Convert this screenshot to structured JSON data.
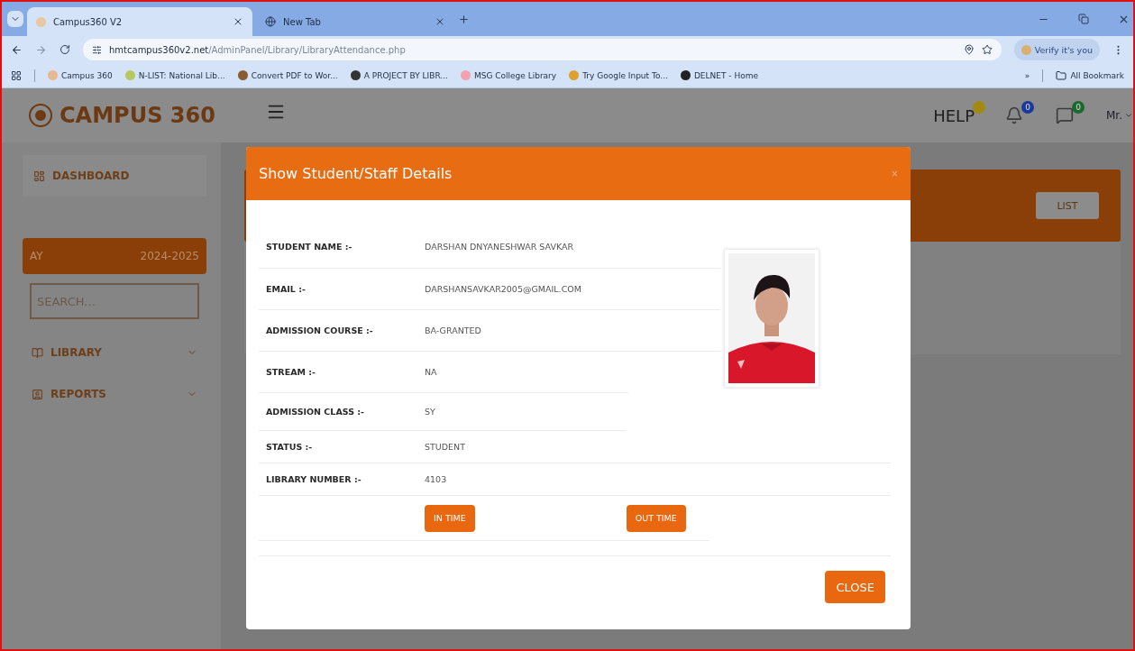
{
  "browser": {
    "tabs": [
      {
        "title": "Campus360 V2",
        "selected": true
      },
      {
        "title": "New Tab",
        "selected": false
      }
    ],
    "url": {
      "host": "hmtcampus360v2.net",
      "path": "/AdminPanel/Library/LibraryAttendance.php"
    },
    "profile_button": "Verify it's you",
    "bookmarks": [
      "Campus 360",
      "N-LIST: National Lib...",
      "Convert PDF to Wor...",
      "A PROJECT BY LIBR...",
      "MSG College Library",
      "Try Google Input To...",
      "DELNET - Home"
    ],
    "overflow": "»",
    "all_bookmarks": "All Bookmark"
  },
  "app": {
    "logo": "CAMPUS 360",
    "header": {
      "help": "HELP",
      "notifications": "0",
      "messages": "0",
      "user": "Mr."
    },
    "sidebar": {
      "dashboard": "DASHBOARD",
      "year": {
        "label": "AY",
        "value": "2024-2025"
      },
      "search": {
        "placeholder": "SEARCH..."
      },
      "menu": [
        {
          "label": "LIBRARY",
          "kind": "library"
        },
        {
          "label": "REPORTS",
          "kind": "reports"
        }
      ]
    },
    "list_button": "LIST"
  },
  "modal": {
    "title": "Show Student/Staff Details",
    "close_symbol": "×",
    "fields": [
      {
        "label": "STUDENT NAME :-",
        "value": "DARSHAN DNYANESHWAR SAVKAR"
      },
      {
        "label": "EMAIL :-",
        "value": "DARSHANSAVKAR2005@GMAIL.COM"
      },
      {
        "label": "ADMISSION COURSE :-",
        "value": "BA-GRANTED"
      },
      {
        "label": "STREAM :-",
        "value": "NA"
      },
      {
        "label": "ADMISSION CLASS :-",
        "value": "SY"
      },
      {
        "label": "STATUS :-",
        "value": "STUDENT"
      },
      {
        "label": "LIBRARY NUMBER :-",
        "value": "4103"
      }
    ],
    "in_button": "IN TIME",
    "out_button": "OUT TIME",
    "close_button": "CLOSE"
  }
}
